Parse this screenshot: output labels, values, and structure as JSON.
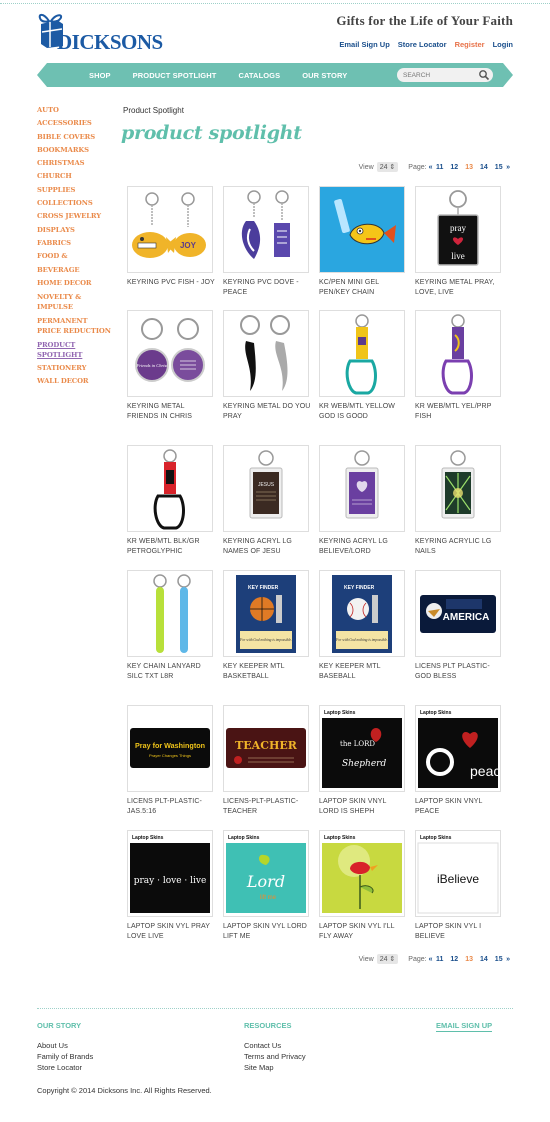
{
  "header": {
    "logo_text": "DICKSONS",
    "tagline": "Gifts for the Life of Your Faith",
    "links": [
      "Email Sign Up",
      "Store Locator",
      "Register",
      "Login"
    ]
  },
  "nav": {
    "items": [
      "Shop",
      "Product Spotlight",
      "Catalogs",
      "Our Story"
    ],
    "search_placeholder": "SEARCH"
  },
  "sidebar": {
    "categories": [
      "AUTO ACCESSORIES",
      "BIBLE COVERS",
      "BOOKMARKS",
      "CHRISTMAS",
      "CHURCH SUPPLIES",
      "COLLECTIONS",
      "CROSS JEWELRY",
      "DISPLAYS",
      "FABRICS",
      "FOOD & BEVERAGE",
      "HOME DECOR",
      "NOVELTY & IMPULSE",
      "PERMANENT PRICE REDUCTION",
      "PRODUCT SPOTLIGHT",
      "STATIONERY",
      "WALL DECOR"
    ],
    "active": "PRODUCT SPOTLIGHT"
  },
  "main": {
    "breadcrumb": "Product Spotlight",
    "title": "product spotlight"
  },
  "pager": {
    "view_label": "View",
    "per_page": "24",
    "page_label": "Page:",
    "prev": "«",
    "pages": [
      "11",
      "12",
      "13",
      "14",
      "15"
    ],
    "current": "13",
    "next": "»"
  },
  "products": [
    {
      "name": "KEYRING PVC FISH - JOY",
      "icon": "keyring-fish-joy"
    },
    {
      "name": "KEYRING PVC DOVE - PEACE",
      "icon": "keyring-dove-peace"
    },
    {
      "name": "KC/PEN MINI GEL PEN/KEY CHAIN",
      "icon": "fish-pen-keychain"
    },
    {
      "name": "KEYRING METAL PRAY, LOVE, LIVE",
      "icon": "keyring-pray-love-live"
    },
    {
      "name": "KEYRING METAL FRIENDS IN CHRIS",
      "icon": "keyring-friends-in-christ"
    },
    {
      "name": "KEYRING METAL DO YOU PRAY",
      "icon": "keyring-mustache"
    },
    {
      "name": "KR WEB/MTL YELLOW GOD IS GOOD",
      "icon": "carabiner-yellow"
    },
    {
      "name": "KR WEB/MTL YEL/PRP FISH",
      "icon": "carabiner-purple"
    },
    {
      "name": "KR WEB/MTL BLK/GR PETROGLYPHIC",
      "icon": "carabiner-red"
    },
    {
      "name": "KEYRING ACRYL LG NAMES OF JESU",
      "icon": "acrylic-keyring-dark"
    },
    {
      "name": "KEYRING ACRYL LG BELIEVE/LORD",
      "icon": "acrylic-keyring-purple"
    },
    {
      "name": "KEYRING ACRYLIC LG NAILS",
      "icon": "acrylic-keyring-nails"
    },
    {
      "name": "KEY CHAIN LANYARD SILC TXT L8R",
      "icon": "silicone-lanyards"
    },
    {
      "name": "KEY KEEPER MTL BASKETBALL",
      "icon": "key-keeper-basketball"
    },
    {
      "name": "KEY KEEPER MTL BASEBALL",
      "icon": "key-keeper-baseball"
    },
    {
      "name": "LICENS PLT PLASTIC-GOD BLESS",
      "icon": "license-plate-america"
    },
    {
      "name": "LICENS PLT-PLASTIC-JAS.5:16",
      "icon": "license-plate-washington"
    },
    {
      "name": "LICENS-PLT-PLASTIC-TEACHER",
      "icon": "license-plate-teacher"
    },
    {
      "name": "LAPTOP SKIN VNYL LORD IS SHEPH",
      "icon": "laptop-skin-shepherd"
    },
    {
      "name": "LAPTOP SKIN VNYL PEACE",
      "icon": "laptop-skin-peace"
    },
    {
      "name": "LAPTOP SKIN VYL PRAY LOVE LIVE",
      "icon": "laptop-skin-pray"
    },
    {
      "name": "LAPTOP SKIN VYL LORD LIFT ME",
      "icon": "laptop-skin-lord"
    },
    {
      "name": "LAPTOP SKIN VYL I'LL FLY AWAY",
      "icon": "laptop-skin-bird"
    },
    {
      "name": "LAPTOP SKIN VYL I BELIEVE",
      "icon": "laptop-skin-ibelieve"
    }
  ],
  "product_art_text": {
    "joy": "JOY",
    "pray": "pray",
    "love": "love",
    "live": "live",
    "friends": "Friends in Christ",
    "jesus": "JESUS",
    "kk_label": "KEY FINDER",
    "kk_quote": "For with God nothing is impossible.",
    "america": "AMERICA",
    "pray_washington": "Pray for Washington",
    "prayer_changes": "Prayer Changes Things",
    "teacher": "TEACHER",
    "laptop_skins": "Laptop Skins",
    "the_lord": "the LORD",
    "shepherd": "Shepherd",
    "peace": "peace",
    "pray_love_live": "pray · love · live",
    "lord": "Lord",
    "lift_me": "lift me",
    "ibelieve": "iBelieve"
  },
  "footer": {
    "our_story": {
      "heading": "OUR STORY",
      "links": [
        "About Us",
        "Family of Brands",
        "Store Locator"
      ]
    },
    "resources": {
      "heading": "RESOURCES",
      "links": [
        "Contact Us",
        "Terms and Privacy",
        "Site Map"
      ]
    },
    "email_signup": "EMAIL SIGN UP",
    "copyright": "Copyright © 2014 Dicksons Inc. All Rights Reserved."
  },
  "colors": {
    "teal": "#6ec0b2",
    "orange": "#ea8a4a",
    "purple": "#9166b1",
    "navy": "#1a4f8c"
  }
}
